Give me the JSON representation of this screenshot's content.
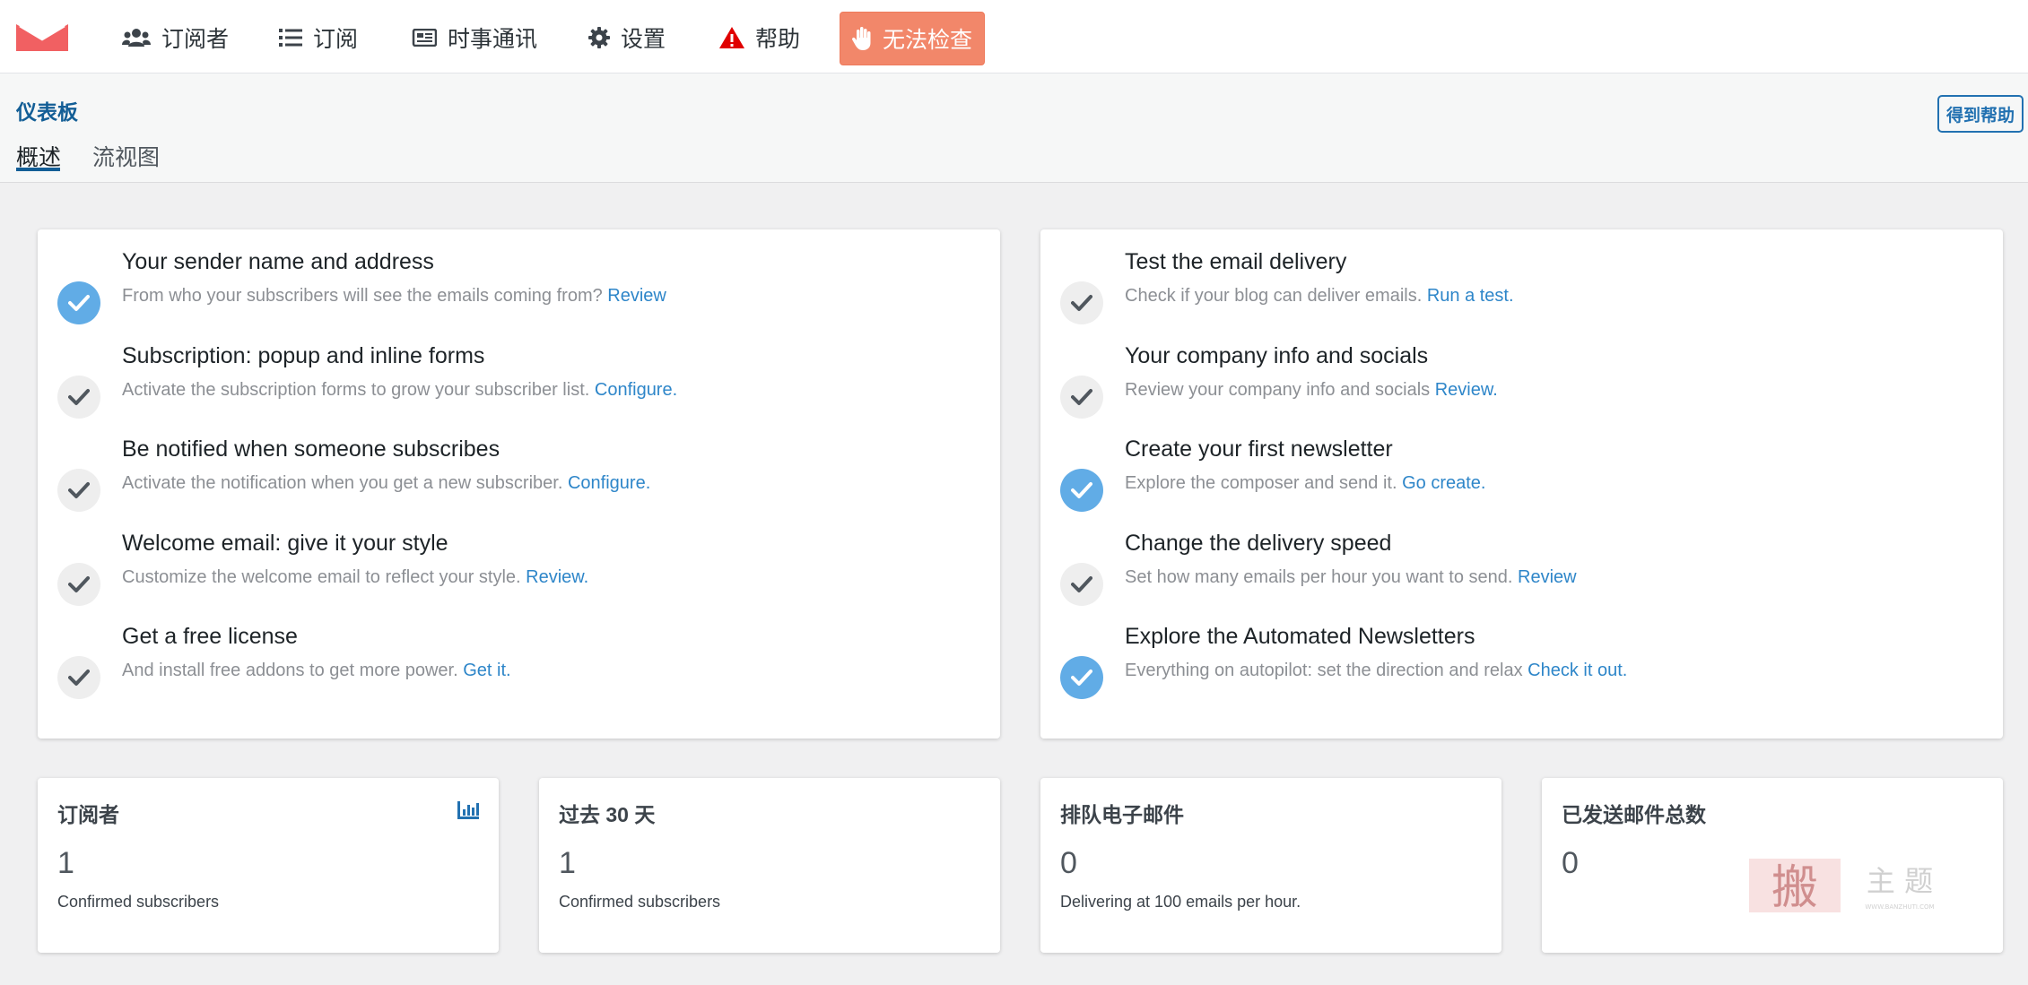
{
  "nav": {
    "items": [
      {
        "label": "订阅者",
        "icon": "users-icon"
      },
      {
        "label": "订阅",
        "icon": "list-icon"
      },
      {
        "label": "时事通讯",
        "icon": "newspaper-icon"
      },
      {
        "label": "设置",
        "icon": "gear-icon"
      },
      {
        "label": "帮助",
        "icon": "warning-triangle-icon"
      }
    ],
    "warning_button": {
      "label": "无法检查",
      "icon": "hand-stop-icon"
    },
    "colors": {
      "accent": "#f2876a",
      "logo": "#f16062",
      "link": "#2e86c9",
      "done": "#61ace6"
    }
  },
  "header": {
    "breadcrumb": "仪表板",
    "tabs": [
      {
        "label": "概述",
        "active": true
      },
      {
        "label": "流视图",
        "active": false
      }
    ],
    "help_button": "得到帮助"
  },
  "tasks_left": [
    {
      "title": "Your sender name and address",
      "desc": "From who your subscribers will see the emails coming from?",
      "link": "Review",
      "done": true
    },
    {
      "title": "Subscription: popup and inline forms",
      "desc": "Activate the subscription forms to grow your subscriber list.",
      "link": "Configure.",
      "done": false
    },
    {
      "title": "Be notified when someone subscribes",
      "desc": "Activate the notification when you get a new subscriber.",
      "link": "Configure.",
      "done": false
    },
    {
      "title": "Welcome email: give it your style",
      "desc": "Customize the welcome email to reflect your style.",
      "link": "Review.",
      "done": false
    },
    {
      "title": "Get a free license",
      "desc": "And install free addons to get more power.",
      "link": "Get it.",
      "done": false
    }
  ],
  "tasks_right": [
    {
      "title": "Test the email delivery",
      "desc": "Check if your blog can deliver emails.",
      "link": "Run a test.",
      "done": false
    },
    {
      "title": "Your company info and socials",
      "desc": "Review your company info and socials",
      "link": "Review.",
      "done": false
    },
    {
      "title": "Create your first newsletter",
      "desc": "Explore the composer and send it.",
      "link": "Go create.",
      "done": true
    },
    {
      "title": "Change the delivery speed",
      "desc": "Set how many emails per hour you want to send.",
      "link": "Review",
      "done": false
    },
    {
      "title": "Explore the Automated Newsletters",
      "desc": "Everything on autopilot: set the direction and relax",
      "link": "Check it out.",
      "done": true
    }
  ],
  "stats": [
    {
      "title": "订阅者",
      "value": "1",
      "caption": "Confirmed subscribers",
      "icon": "bar-chart-icon"
    },
    {
      "title": "过去 30 天",
      "value": "1",
      "caption": "Confirmed subscribers"
    },
    {
      "title": "排队电子邮件",
      "value": "0",
      "caption": "Delivering at 100 emails per hour."
    },
    {
      "title": "已发送邮件总数",
      "value": "0",
      "caption": ""
    }
  ],
  "watermark": {
    "big": "搬",
    "text": "主 题",
    "small": "WWW.BANZHUTI.COM"
  }
}
